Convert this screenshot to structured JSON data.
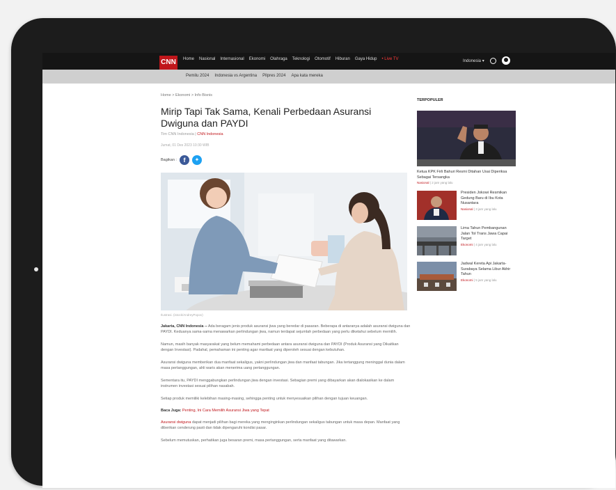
{
  "nav": {
    "logo": "CNN",
    "items": [
      "Home",
      "Nasional",
      "Internasional",
      "Ekonomi",
      "Olahraga",
      "Teknologi",
      "Otomotif",
      "Hiburan",
      "Gaya Hidup"
    ],
    "live": "• Live TV",
    "right_label": "Indonesia ▾"
  },
  "subnav": {
    "items": [
      "Pemilu 2024",
      "Indonesia vs Argentina",
      "Pilpres 2024",
      "Apa kata mereka"
    ]
  },
  "article": {
    "breadcrumb": "Home  >  Ekonomi  >  Info Bisnis",
    "title": "Mirip Tapi Tak Sama, Kenali Perbedaan Asuransi Dwiguna dan PAYDI",
    "author_prefix": "Tim CNN Indonesia | ",
    "author": "CNN Indonesia",
    "date": "Jumat, 01 Des 2023 10:30 WIB",
    "share_label": "Bagikan :",
    "caption": "Ilustrasi. (istock/AndreyPopov)",
    "lead_bold": "Jakarta, CNN Indonesia --",
    "lead_text": " Ada beragam jenis produk asuransi jiwa yang beredar di pasaran. Beberapa di antaranya adalah asuransi dwiguna dan PAYDI. Keduanya sama-sama menawarkan perlindungan jiwa, namun terdapat sejumlah perbedaan yang perlu diketahui sebelum memilih.",
    "para2": "Namun, masih banyak masyarakat yang belum memahami perbedaan antara asuransi dwiguna dan PAYDI (Produk Asuransi yang Dikaitkan dengan Investasi). Padahal, pemahaman ini penting agar manfaat yang diperoleh sesuai dengan kebutuhan.",
    "para3": "Asuransi dwiguna memberikan dua manfaat sekaligus, yakni perlindungan jiwa dan manfaat tabungan. Jika tertanggung meninggal dunia dalam masa pertanggungan, ahli waris akan menerima uang pertanggungan.",
    "para4": "Sementara itu, PAYDI menggabungkan perlindungan jiwa dengan investasi. Sebagian premi yang dibayarkan akan dialokasikan ke dalam instrumen investasi sesuai pilihan nasabah.",
    "para5": "Setiap produk memiliki kelebihan masing-masing, sehingga penting untuk menyesuaikan pilihan dengan tujuan keuangan.",
    "baca_label": "Baca Juga: ",
    "baca_link": "Penting, Ini Cara Memilih Asuransi Jiwa yang Tepat",
    "para6_link": "Asuransi dwiguna",
    "para6": " dapat menjadi pilihan bagi mereka yang menginginkan perlindungan sekaligus tabungan untuk masa depan. Manfaat yang diberikan cenderung pasti dan tidak dipengaruhi kondisi pasar.",
    "para7": "Sebelum memutuskan, perhatikan juga besaran premi, masa pertanggungan, serta manfaat yang ditawarkan."
  },
  "sidebar": {
    "heading": "TERPOPULER",
    "top": {
      "title": "Ketua KPK Firli Bahuri Resmi Ditahan Usai Diperiksa Sebagai Tersangka",
      "category": "Nasional",
      "time": "2 jam yang lalu"
    },
    "items": [
      {
        "title": "Presiden Jokowi Resmikan Gedung Baru di Ibu Kota Nusantara",
        "category": "Nasional",
        "time": "3 jam yang lalu"
      },
      {
        "title": "Lima Tahun Pembangunan Jalan Tol Trans Jawa Capai Target",
        "category": "Ekonomi",
        "time": "4 jam yang lalu"
      },
      {
        "title": "Jadwal Kereta Api Jakarta-Surabaya Selama Libur Akhir Tahun",
        "category": "Ekonomi",
        "time": "5 jam yang lalu"
      }
    ]
  }
}
